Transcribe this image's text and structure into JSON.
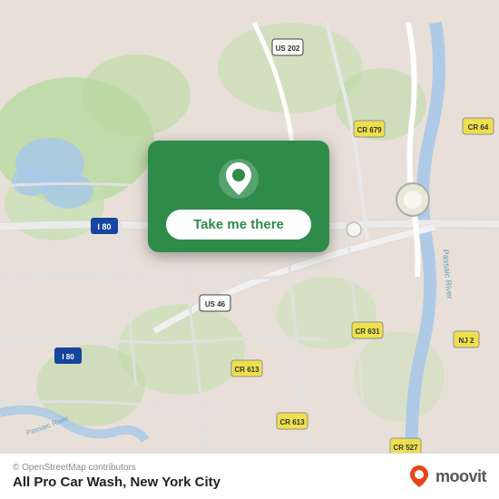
{
  "map": {
    "background_color": "#e8e0d8",
    "attribution": "© OpenStreetMap contributors"
  },
  "card": {
    "button_label": "Take me there",
    "bg_color": "#2e8b4a"
  },
  "bottom_bar": {
    "location_name": "All Pro Car Wash, New York City",
    "attribution": "© OpenStreetMap contributors",
    "moovit_text": "moovit"
  }
}
